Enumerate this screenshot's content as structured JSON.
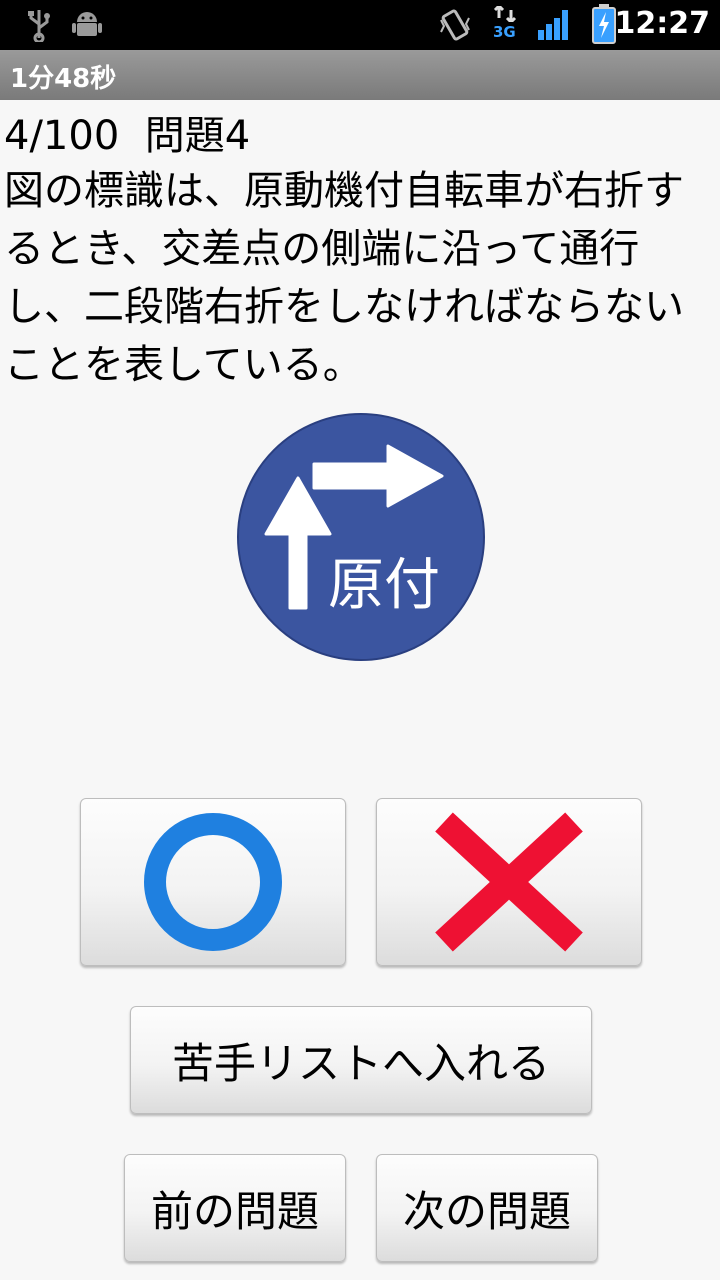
{
  "statusbar": {
    "time": "12:27",
    "icons": [
      "usb-icon",
      "android-debug-icon",
      "vibrate-icon",
      "network-3g-icon",
      "signal-icon",
      "battery-charging-icon"
    ],
    "network_label": "3G"
  },
  "titlebar": {
    "title": "1分48秒"
  },
  "question": {
    "progress": "4/100",
    "label": "問題4",
    "text": "図の標識は、原動機付自転車が右折するとき、交差点の側端に沿って通行し、二段階右折をしなければならないことを表している。"
  },
  "sign": {
    "icon": "moped-two-stage-right-turn-sign",
    "text": "原付",
    "color": "#3b55a0"
  },
  "answers": {
    "correct_icon": "circle-icon",
    "correct_color": "#1f80e0",
    "wrong_icon": "cross-icon",
    "wrong_color": "#ee1133"
  },
  "buttons": {
    "weak_list": "苦手リストへ入れる",
    "prev": "前の問題",
    "next": "次の問題"
  }
}
